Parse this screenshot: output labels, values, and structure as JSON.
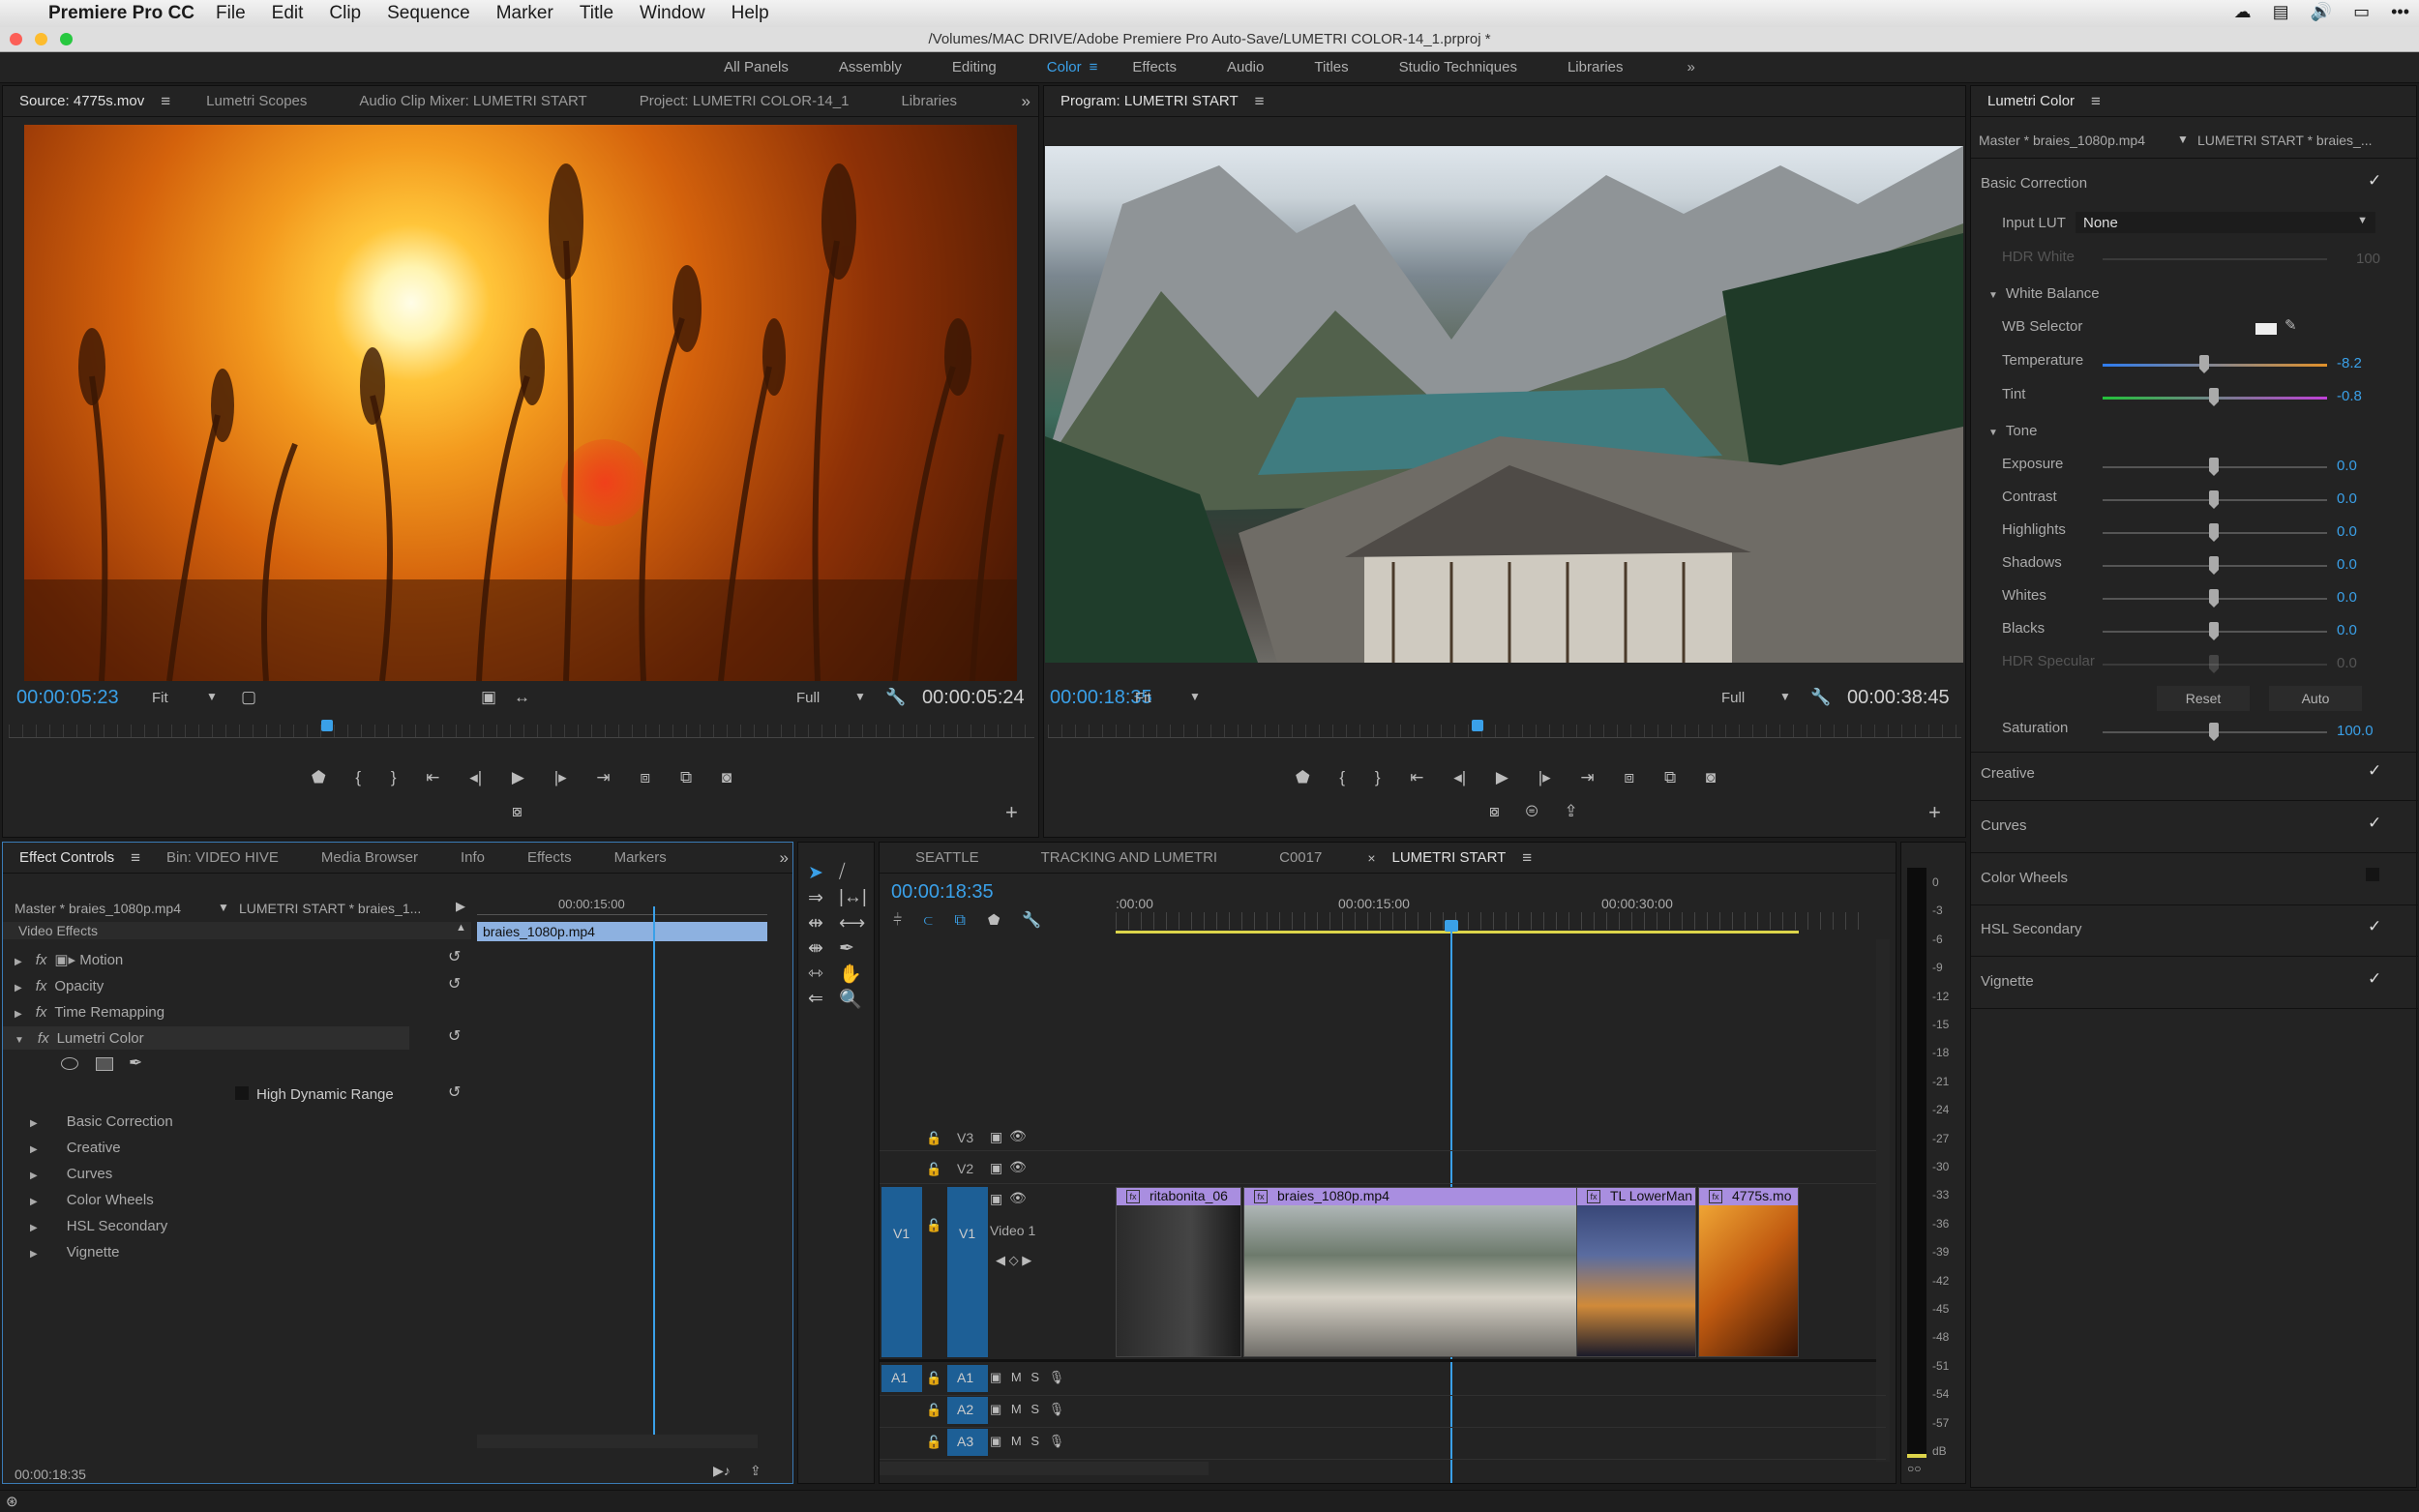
{
  "menubar": {
    "app": "Premiere Pro CC",
    "items": [
      "File",
      "Edit",
      "Clip",
      "Sequence",
      "Marker",
      "Title",
      "Window",
      "Help"
    ]
  },
  "titlebar": {
    "path": "/Volumes/MAC DRIVE/Adobe Premiere Pro Auto-Save/LUMETRI COLOR-14_1.prproj *"
  },
  "workspaces": {
    "items": [
      "All Panels",
      "Assembly",
      "Editing",
      "Color",
      "Effects",
      "Audio",
      "Titles",
      "Studio Techniques",
      "Libraries"
    ],
    "active": "Color",
    "more": "»"
  },
  "source": {
    "tabs": [
      "Source: 4775s.mov",
      "Lumetri Scopes",
      "Audio Clip Mixer: LUMETRI START",
      "Project: LUMETRI COLOR-14_1",
      "Libraries"
    ],
    "timecode": "00:00:05:23",
    "fit": "Fit",
    "quality": "Full",
    "duration": "00:00:05:24",
    "playhead": 0.31
  },
  "program": {
    "tab": "Program: LUMETRI START",
    "timecode": "00:00:18:35",
    "fit": "Fit",
    "quality": "Full",
    "duration": "00:00:38:45",
    "playhead": 0.47
  },
  "lumetri": {
    "title": "Lumetri Color",
    "master": "Master * braies_1080p.mp4",
    "seq": "LUMETRI START * braies_...",
    "basic": "Basic Correction",
    "input_lut_label": "Input LUT",
    "input_lut": "None",
    "hdr_white": "HDR White",
    "hdr_white_val": "100",
    "white_balance": "White Balance",
    "wb_selector": "WB Selector",
    "temperature": "Temperature",
    "temperature_val": "-8.2",
    "tint": "Tint",
    "tint_val": "-0.8",
    "tone": "Tone",
    "tone_rows": [
      {
        "label": "Exposure",
        "value": "0.0"
      },
      {
        "label": "Contrast",
        "value": "0.0"
      },
      {
        "label": "Highlights",
        "value": "0.0"
      },
      {
        "label": "Shadows",
        "value": "0.0"
      },
      {
        "label": "Whites",
        "value": "0.0"
      },
      {
        "label": "Blacks",
        "value": "0.0"
      },
      {
        "label": "HDR Specular",
        "value": "0.0"
      }
    ],
    "reset": "Reset",
    "auto": "Auto",
    "saturation": "Saturation",
    "saturation_val": "100.0",
    "sections": [
      "Creative",
      "Curves",
      "Color Wheels",
      "HSL Secondary",
      "Vignette"
    ]
  },
  "effects": {
    "tabs": [
      "Effect Controls",
      "Bin: VIDEO HIVE",
      "Media Browser",
      "Info",
      "Effects",
      "Markers"
    ],
    "master": "Master * braies_1080p.mp4",
    "seq": "LUMETRI START * braies_1...",
    "ruler_tc": "00:00:15:00",
    "clip": "braies_1080p.mp4",
    "video_effects": "Video Effects",
    "items": [
      "Motion",
      "Opacity",
      "Time Remapping",
      "Lumetri Color"
    ],
    "hdr": "High Dynamic Range",
    "sub": [
      "Basic Correction",
      "Creative",
      "Curves",
      "Color Wheels",
      "HSL Secondary",
      "Vignette"
    ],
    "footer_tc": "00:00:18:35"
  },
  "timeline": {
    "tabs": [
      "SEATTLE",
      "TRACKING AND LUMETRI",
      "C0017",
      "LUMETRI START"
    ],
    "timecode": "00:00:18:35",
    "ruler": [
      ":00:00",
      "00:00:15:00",
      "00:00:30:00"
    ],
    "video_tracks": [
      "V3",
      "V2",
      "V1"
    ],
    "video1_name": "Video 1",
    "audio_tracks": [
      "A1",
      "A2",
      "A3"
    ],
    "clips": [
      "ritabonita_06",
      "braies_1080p.mp4",
      "TL LowerMan",
      "4775s.mo"
    ]
  },
  "meter": {
    "scale": [
      "0",
      "-3",
      "-6",
      "-9",
      "-12",
      "-15",
      "-18",
      "-21",
      "-24",
      "-27",
      "-30",
      "-33",
      "-36",
      "-39",
      "-42",
      "-45",
      "-48",
      "-51",
      "-54",
      "-57",
      "dB"
    ]
  }
}
